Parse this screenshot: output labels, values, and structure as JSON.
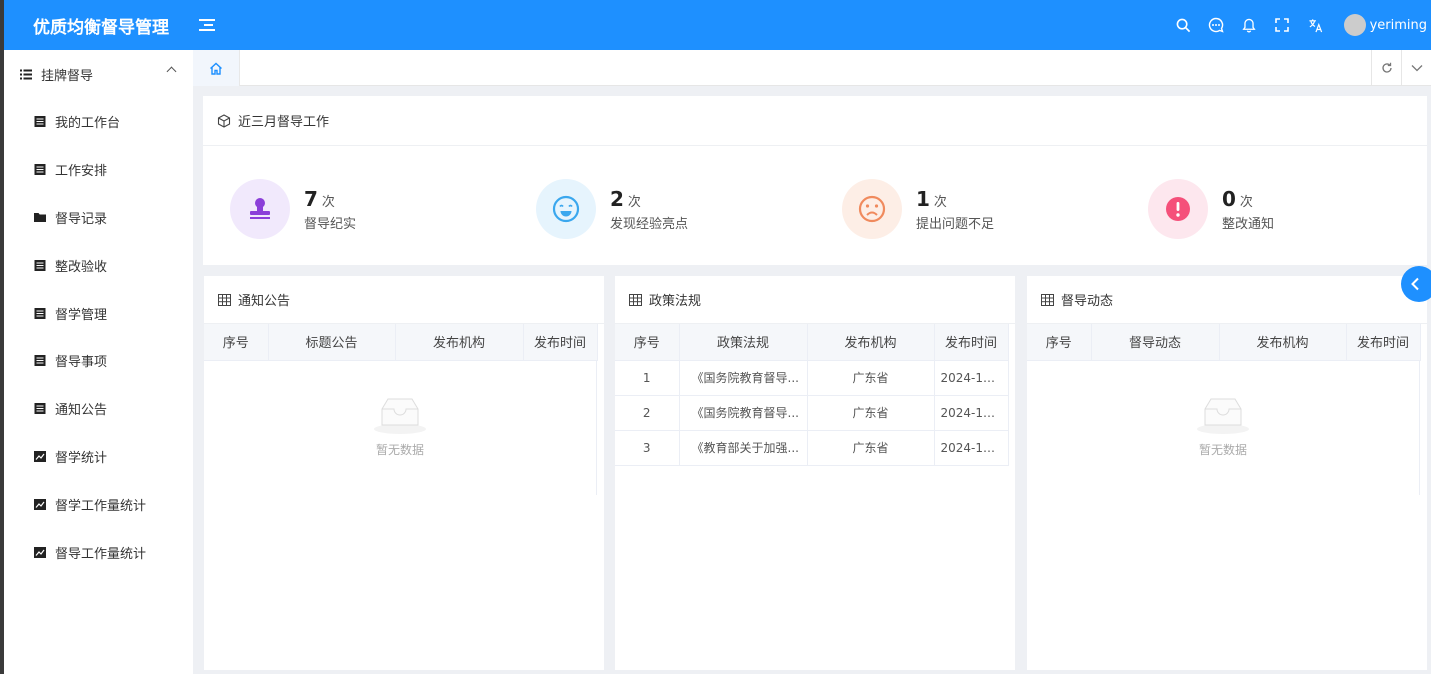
{
  "app": {
    "title": "优质均衡督导管理",
    "username": "yeriming"
  },
  "header_icons": [
    "search-icon",
    "chat-icon",
    "bell-icon",
    "fullscreen-icon",
    "translate-icon"
  ],
  "sidebar": {
    "group": "挂牌督导",
    "items": [
      {
        "label": "我的工作台",
        "icon": "document-icon"
      },
      {
        "label": "工作安排",
        "icon": "document-icon"
      },
      {
        "label": "督导记录",
        "icon": "folder-icon"
      },
      {
        "label": "整改验收",
        "icon": "document-icon"
      },
      {
        "label": "督学管理",
        "icon": "document-icon"
      },
      {
        "label": "督导事项",
        "icon": "document-icon"
      },
      {
        "label": "通知公告",
        "icon": "document-icon"
      },
      {
        "label": "督学统计",
        "icon": "chart-icon"
      },
      {
        "label": "督学工作量统计",
        "icon": "chart-icon"
      },
      {
        "label": "督导工作量统计",
        "icon": "chart-icon"
      }
    ]
  },
  "stats": {
    "title": "近三月督导工作",
    "unit": "次",
    "items": [
      {
        "value": "7",
        "label": "督导纪实",
        "color": "#8b3fd9",
        "bg": "#f1e9fc"
      },
      {
        "value": "2",
        "label": "发现经验亮点",
        "color": "#3aa7ee",
        "bg": "#e6f4fd"
      },
      {
        "value": "1",
        "label": "提出问题不足",
        "color": "#f08a5d",
        "bg": "#fdeee6"
      },
      {
        "value": "0",
        "label": "整改通知",
        "color": "#f5507a",
        "bg": "#fde7ee"
      }
    ]
  },
  "panels": {
    "notice": {
      "title": "通知公告",
      "columns": [
        "序号",
        "标题公告",
        "发布机构",
        "发布时间"
      ],
      "empty": "暂无数据"
    },
    "policy": {
      "title": "政策法规",
      "columns": [
        "序号",
        "政策法规",
        "发布机构",
        "发布时间"
      ],
      "rows": [
        [
          "1",
          "《国务院教育督导...",
          "广东省",
          "2024-10..."
        ],
        [
          "2",
          "《国务院教育督导...",
          "广东省",
          "2024-10..."
        ],
        [
          "3",
          "《教育部关于加强...",
          "广东省",
          "2024-10..."
        ]
      ]
    },
    "dynamics": {
      "title": "督导动态",
      "columns": [
        "序号",
        "督导动态",
        "发布机构",
        "发布时间"
      ],
      "empty": "暂无数据"
    }
  }
}
